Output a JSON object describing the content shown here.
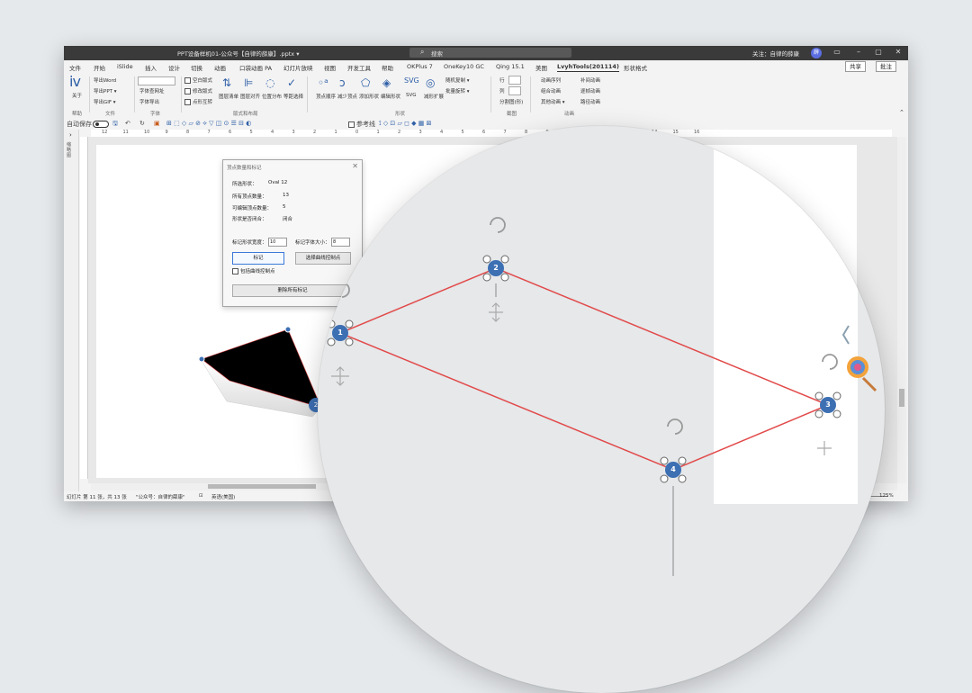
{
  "titlebar": {
    "title": "PPT设备样机01-公众号【自律的薛康】.pptx  ▾",
    "search": "搜索",
    "user": "关注：自律的薛康",
    "avatar": "薛"
  },
  "menu": {
    "tabs": [
      "文件",
      "开始",
      "iSlide",
      "插入",
      "设计",
      "切换",
      "动画",
      "口袋动画 PA",
      "幻灯片放映",
      "视图",
      "开发工具",
      "帮助",
      "OKPlus 7",
      "OneKey10 GC",
      "Qing 15.1",
      "美图",
      "LvyhTools(201114)",
      "形状格式"
    ],
    "active_tab": "LvyhTools(201114)",
    "share": "共享",
    "comment": "批注"
  },
  "ribbon": {
    "about": "关于",
    "export_word": "导出Word",
    "export_ppt": "导出PPT ▾",
    "export_gif": "导出GIF ▾",
    "font_lookup": "字体查网址",
    "font_export": "字体导出",
    "cb_empty_frame": "空白版式",
    "cb_mod_frame": "修改版式",
    "cb_point_check": "点形互转",
    "cmd_1": "图层清单",
    "cmd_2": "图层对齐",
    "cmd_3": "位置分布",
    "cmd_4": "等距选择",
    "cmd_5": "顶点顺序",
    "cmd_6": "减少顶点",
    "cmd_7": "添加形状",
    "cmd_8": "编辑形状",
    "cmd_9": "SVG",
    "cmd_10": "减形扩展",
    "rotate_copy": "随机复制 ▾",
    "batch_rotate": "批量旋转 ▾",
    "row_label": "行",
    "col_label": "列",
    "split_label": "分割图(形)",
    "anim_1": "动画序列",
    "anim_2": "组合动画",
    "anim_3": "其他动画 ▾",
    "anim_4": "补间动画",
    "anim_5": "逐帧动画",
    "anim_6": "路径动画",
    "groups": [
      "帮助",
      "文件",
      "字体",
      "版式和布局",
      "形状",
      "截图",
      "动画"
    ]
  },
  "qat": {
    "autosave": "自动保存",
    "ref_line": "参考线"
  },
  "leftpane": {
    "label": "缩略图"
  },
  "ruler": [
    "12",
    "11",
    "10",
    "9",
    "8",
    "7",
    "6",
    "5",
    "4",
    "3",
    "2",
    "1",
    "0",
    "1",
    "2",
    "3",
    "4",
    "5",
    "6",
    "7",
    "8",
    "9",
    "10",
    "11",
    "12",
    "13",
    "14",
    "15",
    "16"
  ],
  "dialog": {
    "title": "顶点数量和标记",
    "selected_label": "所选形状：",
    "selected_value": "Oval 12",
    "all_points_label": "所有顶点数量：",
    "all_points_value": "13",
    "editable_label": "可编辑顶点数量：",
    "editable_value": "5",
    "closed_label": "形状是否闭合：",
    "closed_value": "闭合",
    "mark_size_label": "标记形状宽度：",
    "mark_size_value": "10",
    "font_size_label": "标记字体大小：",
    "font_size_value": "8",
    "mark_btn": "标记",
    "curve_btn": "选择曲线控制点",
    "include_curve": "包括曲线控制点",
    "delete_btn": "删除所有标记"
  },
  "slide_marks": [
    "1",
    "2"
  ],
  "zoom_marks": [
    "1",
    "2",
    "3",
    "4"
  ],
  "statusbar": {
    "slide_info": "幻灯片 第 11 张，共 13 张",
    "author": "\"公众号：自律的薛康\"",
    "lang": "英语(美国)",
    "zoom": "125%"
  },
  "colors": {
    "accent_blue": "#2f5fa7",
    "marker_blue": "#3d6fb3",
    "path_red": "#e24a4a"
  }
}
